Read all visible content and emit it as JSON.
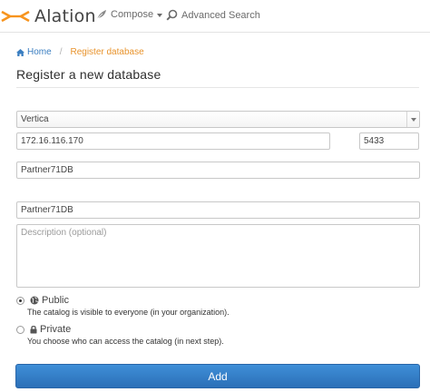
{
  "header": {
    "brand": "Alation",
    "nav": {
      "compose": "Compose",
      "advanced_search": "Advanced Search"
    }
  },
  "breadcrumb": {
    "home": "Home",
    "current": "Register database"
  },
  "page": {
    "title": "Register a new database"
  },
  "form": {
    "db_type": "Vertica",
    "host": "172.16.116.170",
    "port": "5433",
    "db_name": "Partner71DB",
    "title": "Partner71DB",
    "description_placeholder": "Description (optional)",
    "visibility": {
      "selected": "public",
      "public_label": "Public",
      "public_help": "The catalog is visible to everyone (in your organization).",
      "private_label": "Private",
      "private_help": "You choose who can access the catalog (in next step)."
    },
    "submit_label": "Add"
  },
  "colors": {
    "brand_orange": "#f7941d",
    "link_blue": "#3a7ec1",
    "breadcrumb_active": "#e8932c",
    "primary_button": "#2f7bc4"
  },
  "icons": {
    "logo": "alation-logo-icon",
    "compose": "feather-icon",
    "advanced_search": "search-icon",
    "home": "home-icon",
    "public": "globe-icon",
    "private": "lock-icon"
  }
}
